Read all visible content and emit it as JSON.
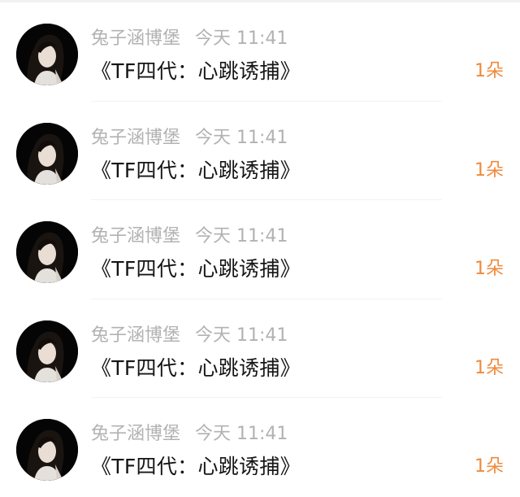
{
  "messages": [
    {
      "sender": "兔子涵博堡",
      "time": "今天 11:41",
      "text": "《TF四代：心跳诱捕》",
      "count": "1朵"
    },
    {
      "sender": "兔子涵博堡",
      "time": "今天 11:41",
      "text": "《TF四代：心跳诱捕》",
      "count": "1朵"
    },
    {
      "sender": "兔子涵博堡",
      "time": "今天 11:41",
      "text": "《TF四代：心跳诱捕》",
      "count": "1朵"
    },
    {
      "sender": "兔子涵博堡",
      "time": "今天 11:41",
      "text": "《TF四代：心跳诱捕》",
      "count": "1朵"
    },
    {
      "sender": "兔子涵博堡",
      "time": "今天 11:41",
      "text": "《TF四代：心跳诱捕》",
      "count": "1朵"
    }
  ],
  "colors": {
    "sender": "#b2b2b2",
    "text": "#151515",
    "count": "#ef8a3c",
    "avatar_bg": "#050505"
  }
}
